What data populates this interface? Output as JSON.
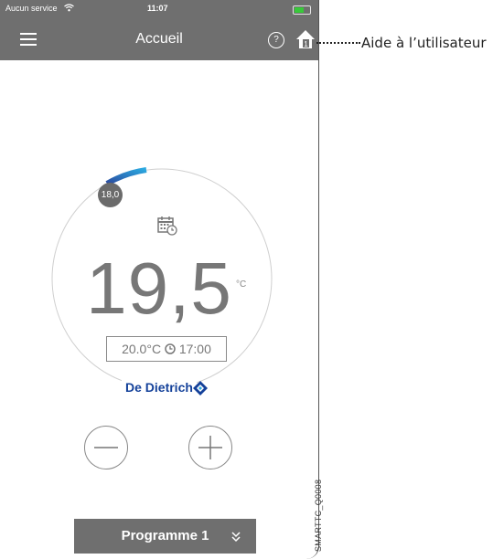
{
  "status_bar": {
    "carrier": "Aucun service",
    "time": "11:07"
  },
  "nav": {
    "title": "Accueil"
  },
  "annotation": {
    "label": "Aide à l’utilisateur"
  },
  "thermostat": {
    "current_temperature": "19,5",
    "unit": "°C",
    "setpoint_badge": "18,0",
    "next_change_temp": "20.0°C",
    "next_change_time": "17:00",
    "brand": "De Dietrich"
  },
  "program": {
    "label": "Programme 1"
  },
  "figure_code": "SMARTTC_Q0008",
  "colors": {
    "bar": "#6f6f6f",
    "brand": "#14419a",
    "arc_start": "#2ba8e0",
    "arc_end": "#2b4a9e"
  },
  "icons": {
    "menu": "hamburger-icon",
    "help": "question-icon",
    "home": "home-icon",
    "calendar": "calendar-clock-icon",
    "minus": "minus-icon",
    "plus": "plus-icon",
    "chevron": "double-chevron-down-icon",
    "clock": "clock-icon"
  }
}
